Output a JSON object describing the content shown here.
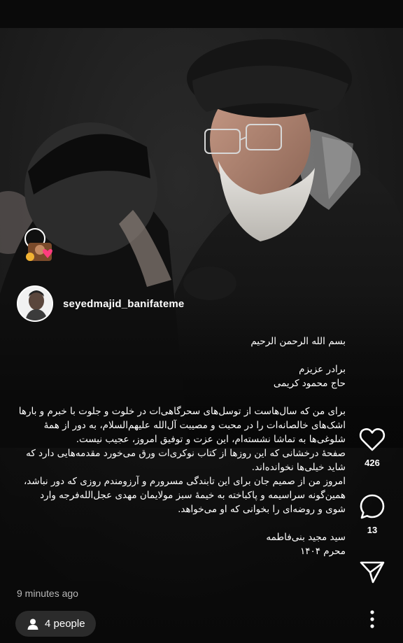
{
  "post": {
    "username": "seyedmajid_banifateme",
    "caption": [
      "بسم الله الرحمن الرحیم",
      "",
      "برادر عزیزم",
      "حاج محمود کریمی",
      "",
      "برای من که سال‌هاست از توسل‌های سحرگاهی‌ات در خلوت و جلوت با خبرم و بارها اشک‌های خالصانه‌ات را در محبت و مصیبت آل‌الله علیهم‌السلام، به دور از همهٔ شلوغی‌ها به تماشا نشسته‌ام، این عزت و توفیق امروز، عجیب نیست.",
      "صفحهٔ درخشانی که این روزها از کتاب نوکری‌ات ورق می‌خورد مقدمه‌هایی دارد که شاید خیلی‌ها نخوانده‌اند.",
      "امروز من از صمیم جان برای این تابندگی مسرورم و آرزومندم روزی که دور نباشد، همین‌گونه سراسیمه و پاکباخته به خیمهٔ سبز مولایمان مهدی عجل‌الله‌فرجه وارد شوی و روضه‌ای را بخوانی که او می‌خواهد.",
      "",
      "سید مجید بنی‌فاطمه",
      "محرم ۱۴۰۴"
    ],
    "timestamp": "9 minutes ago",
    "people_tag": "4 people"
  },
  "actions": {
    "like_count": "426",
    "comment_count": "13",
    "like_icon": "heart-icon",
    "comment_icon": "comment-icon",
    "share_icon": "send-icon",
    "more_icon": "more-icon"
  },
  "colors": {
    "background": "#0d0d0d",
    "text": "#ffffff",
    "muted": "#b8b8b8",
    "pill": "#2b2b2b"
  }
}
